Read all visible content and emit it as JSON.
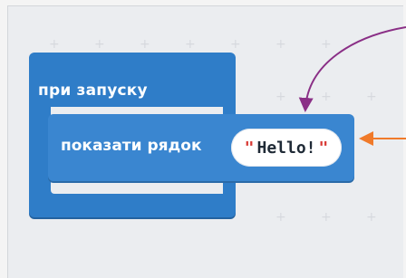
{
  "blocks": {
    "on_start_label": "при запуску",
    "show_string_label": "показати рядок",
    "string_value": "Hello!",
    "quote_open": "\"",
    "quote_close": "\""
  },
  "colors": {
    "block_blue": "#2f7dc8",
    "block_blue_inner": "#3a86d0",
    "arrow_purple": "#8a2f86",
    "arrow_orange": "#f07a2a"
  },
  "icons": {
    "arrow_purple": "curved-arrow-icon",
    "arrow_orange": "straight-arrow-icon"
  }
}
